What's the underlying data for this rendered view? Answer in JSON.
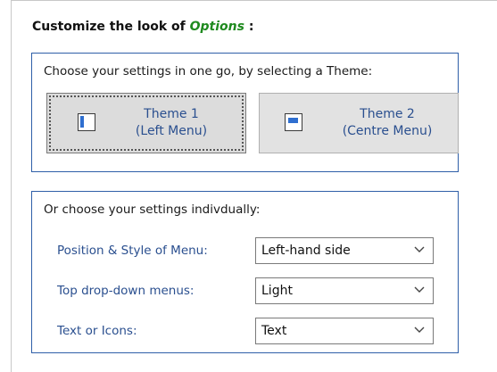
{
  "heading": {
    "prefix": "Customize the look of ",
    "highlight": "Options",
    "suffix": " :"
  },
  "themes": {
    "title": "Choose your settings in one go, by selecting a Theme:",
    "items": [
      {
        "line1": "Theme 1",
        "line2": "(Left Menu)"
      },
      {
        "line1": "Theme 2",
        "line2": "(Centre Menu)"
      }
    ]
  },
  "individual": {
    "title": "Or choose your settings indivdually:",
    "rows": [
      {
        "label": "Position & Style of Menu:",
        "value": "Left-hand side"
      },
      {
        "label": "Top drop-down menus:",
        "value": "Light"
      },
      {
        "label": "Text or Icons:",
        "value": "Text"
      }
    ]
  },
  "colors": {
    "group_border": "#2f5fa8",
    "label_blue": "#2a4f8f",
    "highlight_green": "#1f8a1f",
    "icon_blue": "#2f6fd0"
  }
}
